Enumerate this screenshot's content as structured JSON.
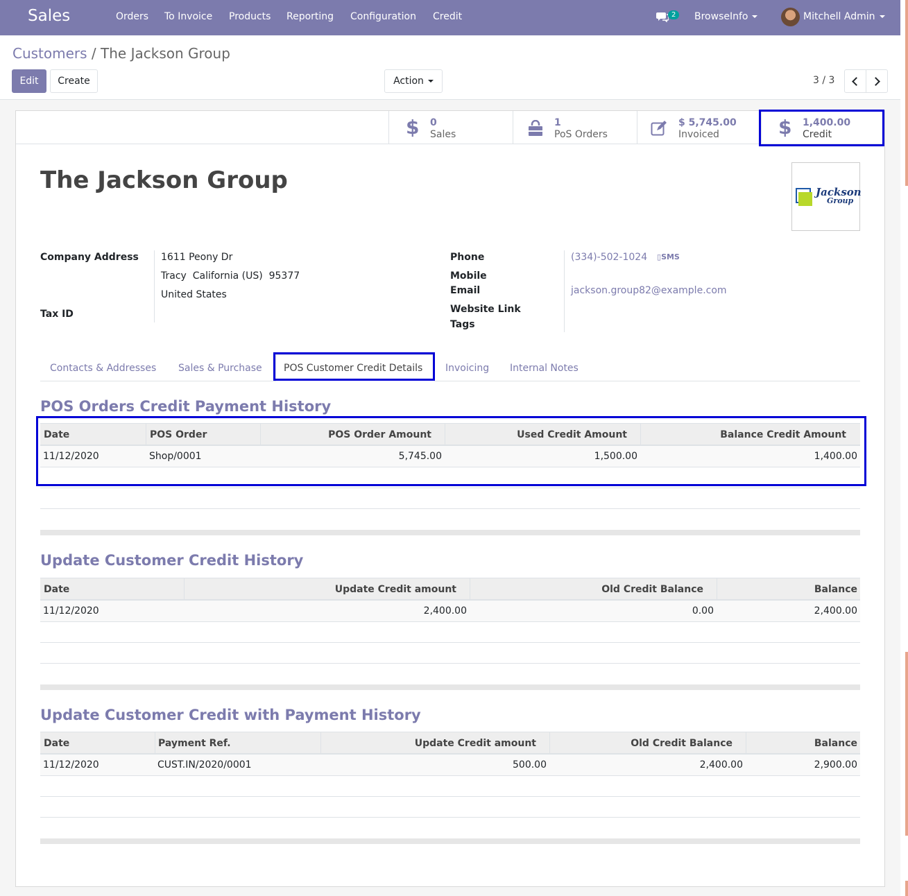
{
  "navbar": {
    "app_name": "Sales",
    "menu": [
      "Orders",
      "To Invoice",
      "Products",
      "Reporting",
      "Configuration",
      "Credit"
    ],
    "chat_count": "2",
    "company": "BrowseInfo",
    "user": "Mitchell Admin"
  },
  "breadcrumb": {
    "parent": "Customers",
    "separator": " / ",
    "current": "The Jackson Group"
  },
  "buttons": {
    "edit": "Edit",
    "create": "Create",
    "action": "Action"
  },
  "pager": {
    "value": "3 / 3"
  },
  "stat_buttons": [
    {
      "icon": "dollar-icon",
      "value": "0",
      "label": "Sales"
    },
    {
      "icon": "shopping-bag-icon",
      "value": "1",
      "label": "PoS Orders"
    },
    {
      "icon": "edit-icon",
      "value": "$ 5,745.00",
      "label": "Invoiced"
    },
    {
      "icon": "dollar-icon",
      "value": "1,400.00",
      "label": "Credit"
    }
  ],
  "partner": {
    "name": "The Jackson Group",
    "logo_text": [
      "Jackson",
      "Group"
    ],
    "labels": {
      "company_address": "Company Address",
      "tax_id": "Tax ID",
      "phone": "Phone",
      "mobile": "Mobile",
      "email": "Email",
      "website": "Website Link",
      "tags": "Tags"
    },
    "street": "1611 Peony Dr",
    "city_line": "Tracy  California (US)  95377",
    "country": "United States",
    "phone": "(334)-502-1024",
    "sms_label": "SMS",
    "email": "jackson.group82@example.com"
  },
  "tabs": [
    "Contacts & Addresses",
    "Sales & Purchase",
    "POS Customer Credit Details",
    "Invoicing",
    "Internal Notes"
  ],
  "active_tab": "POS Customer Credit Details",
  "pos_history": {
    "title": "POS Orders Credit Payment History",
    "columns": [
      "Date",
      "POS Order",
      "POS Order Amount",
      "Used Credit Amount",
      "Balance Credit Amount"
    ],
    "rows": [
      [
        "11/12/2020",
        "Shop/0001",
        "5,745.00",
        "1,500.00",
        "1,400.00"
      ]
    ]
  },
  "update_history": {
    "title": "Update Customer Credit History",
    "columns": [
      "Date",
      "Update Credit amount",
      "Old Credit Balance",
      "Balance"
    ],
    "rows": [
      [
        "11/12/2020",
        "2,400.00",
        "0.00",
        "2,400.00"
      ]
    ]
  },
  "payment_history": {
    "title": "Update Customer Credit with Payment History",
    "columns": [
      "Date",
      "Payment Ref.",
      "Update Credit amount",
      "Old Credit Balance",
      "Balance"
    ],
    "rows": [
      [
        "11/12/2020",
        "CUST.IN/2020/0001",
        "500.00",
        "2,400.00",
        "2,900.00"
      ]
    ]
  },
  "colors": {
    "brand": "#7c7bad",
    "highlight": "#0000d6",
    "chat_badge": "#00a09d"
  }
}
